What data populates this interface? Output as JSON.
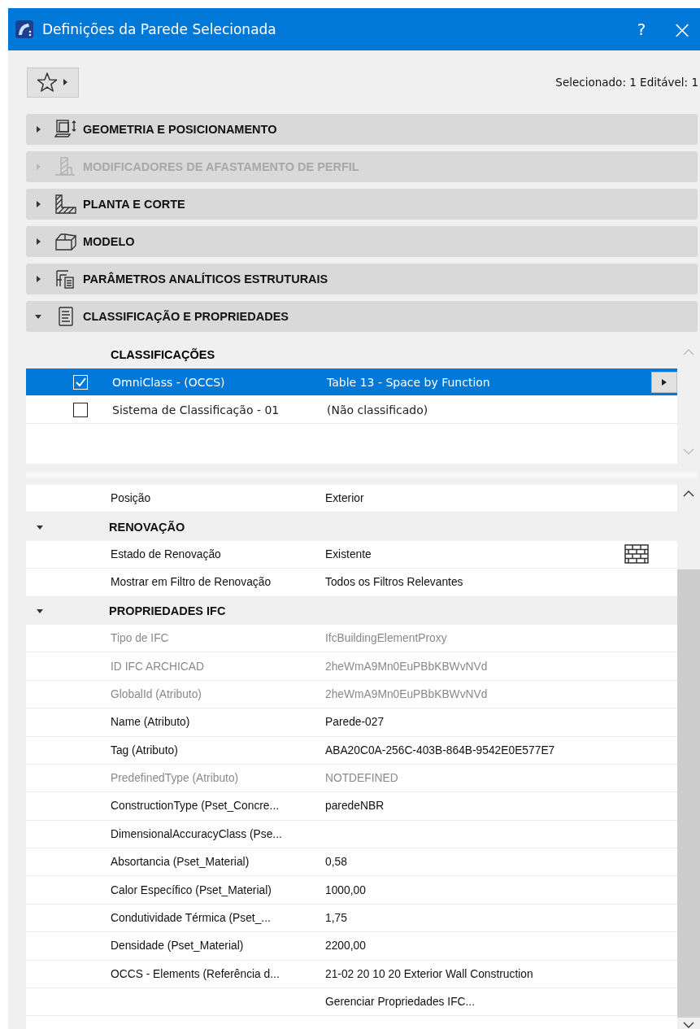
{
  "window": {
    "title": "Definições da Parede Selecionada",
    "help": "?",
    "close": "×"
  },
  "toolbar": {
    "status": "Selecionado: 1 Editável: 1"
  },
  "sections": [
    {
      "title": "GEOMETRIA E POSICIONAMENTO",
      "disabled": false,
      "expanded": false
    },
    {
      "title": "MODIFICADORES DE AFASTAMENTO DE PERFIL",
      "disabled": true,
      "expanded": false
    },
    {
      "title": "PLANTA E CORTE",
      "disabled": false,
      "expanded": false
    },
    {
      "title": "MODELO",
      "disabled": false,
      "expanded": false
    },
    {
      "title": "PARÂMETROS ANALÍTICOS ESTRUTURAIS",
      "disabled": false,
      "expanded": false
    },
    {
      "title": "CLASSIFICAÇÃO E PROPRIEDADES",
      "disabled": false,
      "expanded": true
    }
  ],
  "classifications": {
    "heading": "CLASSIFICAÇÕES",
    "rows": [
      {
        "name": "OmniClass - (OCCS)",
        "value": "Table 13 - Space by Function",
        "checked": true,
        "selected": true
      },
      {
        "name": "Sistema de Classificação - 01",
        "value": "(Não classificado)",
        "checked": false,
        "selected": false
      }
    ]
  },
  "properties": [
    {
      "kind": "row",
      "label": "Posição",
      "value": "Exterior",
      "dimmed": false
    },
    {
      "kind": "group",
      "label": "RENOVAÇÃO",
      "expanded": true
    },
    {
      "kind": "row",
      "label": "Estado de Renovação",
      "value": "Existente",
      "dimmed": false,
      "picker": true
    },
    {
      "kind": "row",
      "label": "Mostrar em Filtro de Renovação",
      "value": "Todos os Filtros Relevantes",
      "dimmed": false
    },
    {
      "kind": "group",
      "label": "PROPRIEDADES IFC",
      "expanded": true
    },
    {
      "kind": "row",
      "label": "Tipo de IFC",
      "value": "IfcBuildingElementProxy",
      "dimmed": true
    },
    {
      "kind": "row",
      "label": "ID IFC ARCHICAD",
      "value": "2heWmA9Mn0EuPBbKBWvNVd",
      "dimmed": true
    },
    {
      "kind": "row",
      "label": "GlobalId (Atributo)",
      "value": "2heWmA9Mn0EuPBbKBWvNVd",
      "dimmed": true
    },
    {
      "kind": "row",
      "label": "Name (Atributo)",
      "value": "Parede-027",
      "dimmed": false
    },
    {
      "kind": "row",
      "label": "Tag (Atributo)",
      "value": "ABA20C0A-256C-403B-864B-9542E0E577E7",
      "dimmed": false
    },
    {
      "kind": "row",
      "label": "PredefinedType (Atributo)",
      "value": "NOTDEFINED",
      "dimmed": true
    },
    {
      "kind": "row",
      "label": "ConstructionType (Pset_Concre...",
      "value": "paredeNBR",
      "dimmed": false
    },
    {
      "kind": "row",
      "label": "DimensionalAccuracyClass (Pse...",
      "dimmed": false
    },
    {
      "kind": "row",
      "label": "Absortancia (Pset_Material)",
      "value": "0,58",
      "dimmed": false
    },
    {
      "kind": "row",
      "label": "Calor Específico (Pset_Material)",
      "value": "1000,00",
      "dimmed": false
    },
    {
      "kind": "row",
      "label": "Condutividade Térmica (Pset_...",
      "value": "1,75",
      "dimmed": false
    },
    {
      "kind": "row",
      "label": "Densidade (Pset_Material)",
      "value": "2200,00",
      "dimmed": false
    },
    {
      "kind": "row",
      "label": "OCCS - Elements (Referência d...",
      "value": "21-02 20 10 20 Exterior Wall Construction",
      "dimmed": false
    },
    {
      "kind": "link",
      "value": "Gerenciar Propriedades IFC..."
    }
  ]
}
